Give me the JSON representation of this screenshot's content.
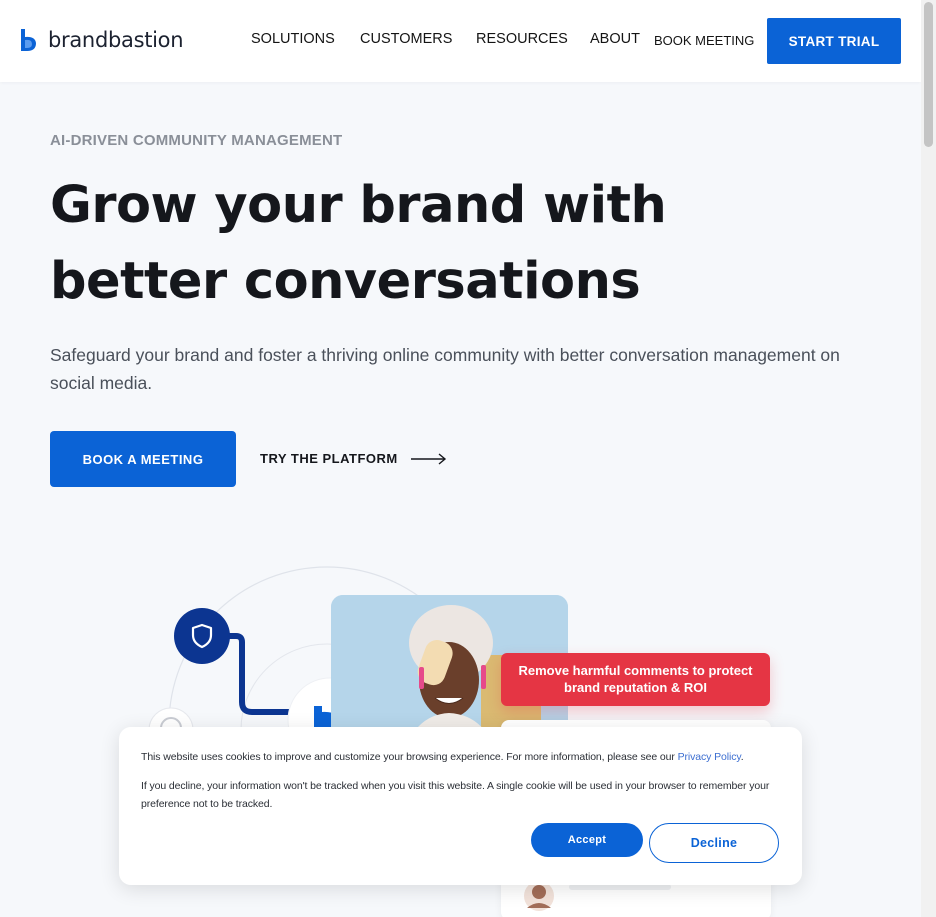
{
  "brand": {
    "name": "brandbastion",
    "logo_icon": "brandbastion-logo-icon",
    "accent": "#0b63d6"
  },
  "nav": {
    "items": [
      {
        "label": "SOLUTIONS"
      },
      {
        "label": "CUSTOMERS"
      },
      {
        "label": "RESOURCES"
      },
      {
        "label": "ABOUT"
      },
      {
        "label": "BOOK MEETING"
      }
    ],
    "cta": "START TRIAL"
  },
  "hero": {
    "eyebrow": "AI-DRIVEN COMMUNITY MANAGEMENT",
    "headline": "Grow your brand with better conversations",
    "subtext": "Safeguard your brand and foster a thriving online community with better conversation management on social media.",
    "primary_button": "BOOK A MEETING",
    "secondary_link": "TRY THE PLATFORM",
    "secondary_icon": "arrow-right-icon"
  },
  "illustration": {
    "callout": "Remove harmful comments to protect brand reputation & ROI",
    "callout_color": "#e53544",
    "badge_icon": "shield-icon"
  },
  "cookie_banner": {
    "text1_prefix": "This website uses cookies to improve and customize your browsing experience. For more information, please see our ",
    "privacy_link": "Privacy Policy",
    "text1_suffix": ".",
    "text2": "If you decline, your information won't be tracked when you visit this website. A single cookie will be used in your browser to remember your preference not to be tracked.",
    "accept": "Accept",
    "decline": "Decline"
  }
}
